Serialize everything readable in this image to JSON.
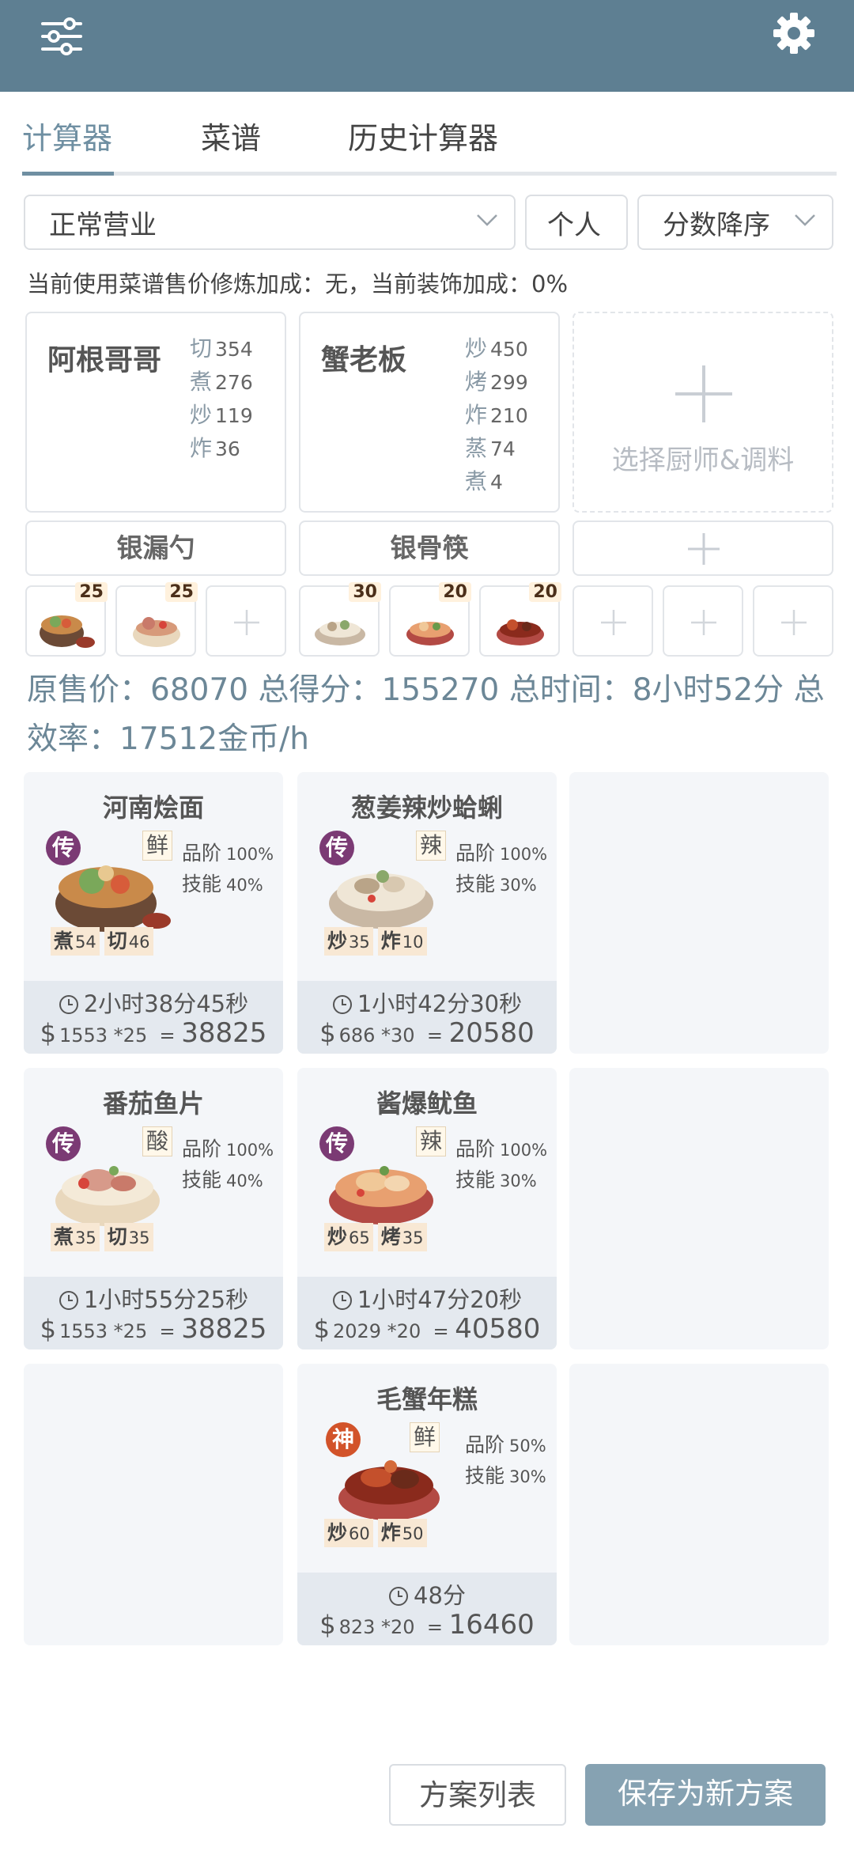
{
  "tabs": [
    "计算器",
    "菜谱",
    "历史计算器"
  ],
  "filters": {
    "mode": "正常营业",
    "scope": "个人",
    "sort": "分数降序"
  },
  "hint": "当前使用菜谱售价修炼加成：无，当前装饰加成：0%",
  "chefs": [
    {
      "name": "阿根哥哥",
      "skills": [
        [
          "切",
          "354"
        ],
        [
          "煮",
          "276"
        ],
        [
          "炒",
          "119"
        ],
        [
          "炸",
          "36"
        ]
      ]
    },
    {
      "name": "蟹老板",
      "skills": [
        [
          "炒",
          "450"
        ],
        [
          "烤",
          "299"
        ],
        [
          "炸",
          "210"
        ],
        [
          "蒸",
          "74"
        ],
        [
          "煮",
          "4"
        ]
      ]
    }
  ],
  "empty_chef_label": "选择厨师&调料",
  "equips": [
    "银漏勺",
    "银骨筷"
  ],
  "slot_counts": [
    "25",
    "25",
    "30",
    "20",
    "20"
  ],
  "summary": "原售价：68070 总得分：155270 总时间：8小时52分 总效率：17512金币/h",
  "dishes": [
    {
      "title": "河南烩面",
      "rank": "传",
      "flavor": "鲜",
      "grade": "100%",
      "skill": "40%",
      "reqs": [
        [
          "煮",
          "54"
        ],
        [
          "切",
          "46"
        ]
      ],
      "time": "2小时38分45秒",
      "price": "1553",
      "mult": "*25",
      "total": "38825"
    },
    {
      "title": "葱姜辣炒蛤蜊",
      "rank": "传",
      "flavor": "辣",
      "grade": "100%",
      "skill": "30%",
      "reqs": [
        [
          "炒",
          "35"
        ],
        [
          "炸",
          "10"
        ]
      ],
      "time": "1小时42分30秒",
      "price": "686",
      "mult": "*30",
      "total": "20580"
    },
    {
      "title": "番茄鱼片",
      "rank": "传",
      "flavor": "酸",
      "grade": "100%",
      "skill": "40%",
      "reqs": [
        [
          "煮",
          "35"
        ],
        [
          "切",
          "35"
        ]
      ],
      "time": "1小时55分25秒",
      "price": "1553",
      "mult": "*25",
      "total": "38825"
    },
    {
      "title": "酱爆鱿鱼",
      "rank": "传",
      "flavor": "辣",
      "grade": "100%",
      "skill": "30%",
      "reqs": [
        [
          "炒",
          "65"
        ],
        [
          "烤",
          "35"
        ]
      ],
      "time": "1小时47分20秒",
      "price": "2029",
      "mult": "*20",
      "total": "40580"
    },
    {
      "title": "毛蟹年糕",
      "rank": "神",
      "flavor": "鲜",
      "grade": "50%",
      "skill": "30%",
      "reqs": [
        [
          "炒",
          "60"
        ],
        [
          "炸",
          "50"
        ]
      ],
      "time": "48分",
      "price": "823",
      "mult": "*20",
      "total": "16460"
    }
  ],
  "labels": {
    "grade": "品阶",
    "skill": "技能",
    "eq": "=",
    "dollar": "$"
  },
  "buttons": {
    "list": "方案列表",
    "save": "保存为新方案"
  },
  "colors": {
    "header": "#5e7f92",
    "accent": "#6f8fa2",
    "primary_btn": "#86a2b2",
    "rank_chuan": "#7b3a74",
    "rank_shen": "#d2532a"
  },
  "icons": {
    "menu": "sliders-icon",
    "settings": "gear-icon",
    "time": "clock-icon",
    "add": "plus-icon"
  }
}
